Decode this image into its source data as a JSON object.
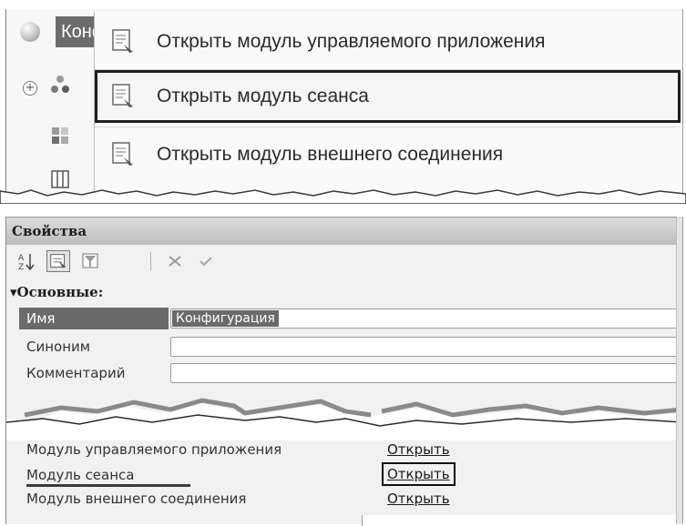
{
  "config_tree": {
    "root_label": "Конфигурация"
  },
  "context_menu": {
    "items": [
      {
        "label": "Открыть модуль управляемого приложения",
        "icon": "module-doc-icon",
        "selected": false
      },
      {
        "label": "Открыть модуль сеанса",
        "icon": "module-doc-icon",
        "selected": true
      },
      {
        "label": "Открыть модуль внешнего соединения",
        "icon": "module-doc-icon",
        "selected": false
      }
    ]
  },
  "properties": {
    "title": "Свойства",
    "toolbar": {
      "sort_icon": "sort-az-icon",
      "categories_icon": "categories-icon",
      "filter_icon": "filter-icon",
      "clear_icon": "clear-x-icon",
      "apply_icon": "checkmark-icon"
    },
    "group": "▾Основные:",
    "rows": [
      {
        "name": "Имя",
        "value": "Конфигурация"
      },
      {
        "name": "Синоним",
        "value": ""
      },
      {
        "name": "Комментарий",
        "value": ""
      }
    ],
    "module_rows": [
      {
        "name": "Модуль управляемого приложения",
        "link": "Открыть"
      },
      {
        "name": "Модуль сеанса",
        "link": "Открыть"
      },
      {
        "name": "Модуль внешнего соединения",
        "link": "Открыть"
      }
    ]
  },
  "colors": {
    "selection_gray": "#6a6a6a",
    "panel_bg": "#f1f1f1",
    "menu_bg": "#fafafa"
  }
}
